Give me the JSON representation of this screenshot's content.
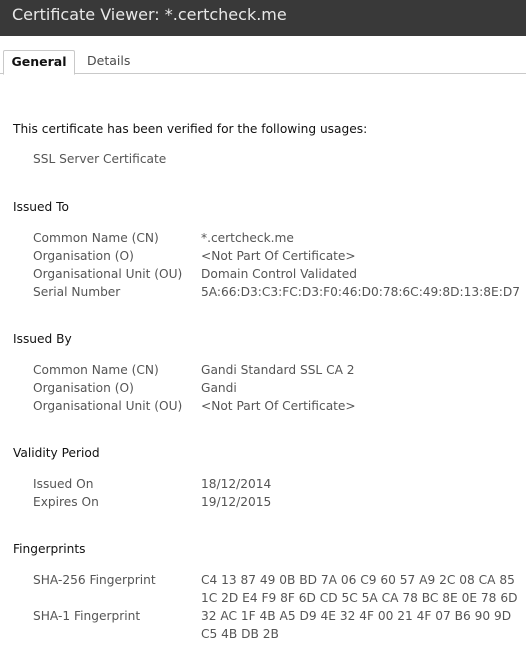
{
  "window": {
    "title": "Certificate Viewer: *.certcheck.me"
  },
  "tabs": {
    "general": "General",
    "details": "Details"
  },
  "intro": {
    "text": "This certificate has been verified for the following usages:",
    "usage": "SSL Server Certificate"
  },
  "issued_to": {
    "heading": "Issued To",
    "cn_label": "Common Name (CN)",
    "cn_value": "*.certcheck.me",
    "o_label": "Organisation (O)",
    "o_value": "<Not Part Of Certificate>",
    "ou_label": "Organisational Unit (OU)",
    "ou_value": "Domain Control Validated",
    "serial_label": "Serial Number",
    "serial_value": "5A:66:D3:C3:FC:D3:F0:46:D0:78:6C:49:8D:13:8E:D7"
  },
  "issued_by": {
    "heading": "Issued By",
    "cn_label": "Common Name (CN)",
    "cn_value": "Gandi Standard SSL CA 2",
    "o_label": "Organisation (O)",
    "o_value": "Gandi",
    "ou_label": "Organisational Unit (OU)",
    "ou_value": "<Not Part Of Certificate>"
  },
  "validity": {
    "heading": "Validity Period",
    "issued_label": "Issued On",
    "issued_value": "18/12/2014",
    "expires_label": "Expires On",
    "expires_value": "19/12/2015"
  },
  "fingerprints": {
    "heading": "Fingerprints",
    "sha256_label": "SHA-256 Fingerprint",
    "sha256_line1": "C4 13 87 49 0B BD 7A 06 C9 60 57 A9 2C 08 CA 85",
    "sha256_line2": "1C 2D E4 F9 8F 6D CD 5C 5A CA 78 BC 8E 0E 78 6D",
    "sha1_label": "SHA-1 Fingerprint",
    "sha1_line1": "32 AC 1F 4B A5 D9 4E 32 4F 00 21 4F 07 B6 90 9D",
    "sha1_line2": "C5 4B DB 2B"
  }
}
